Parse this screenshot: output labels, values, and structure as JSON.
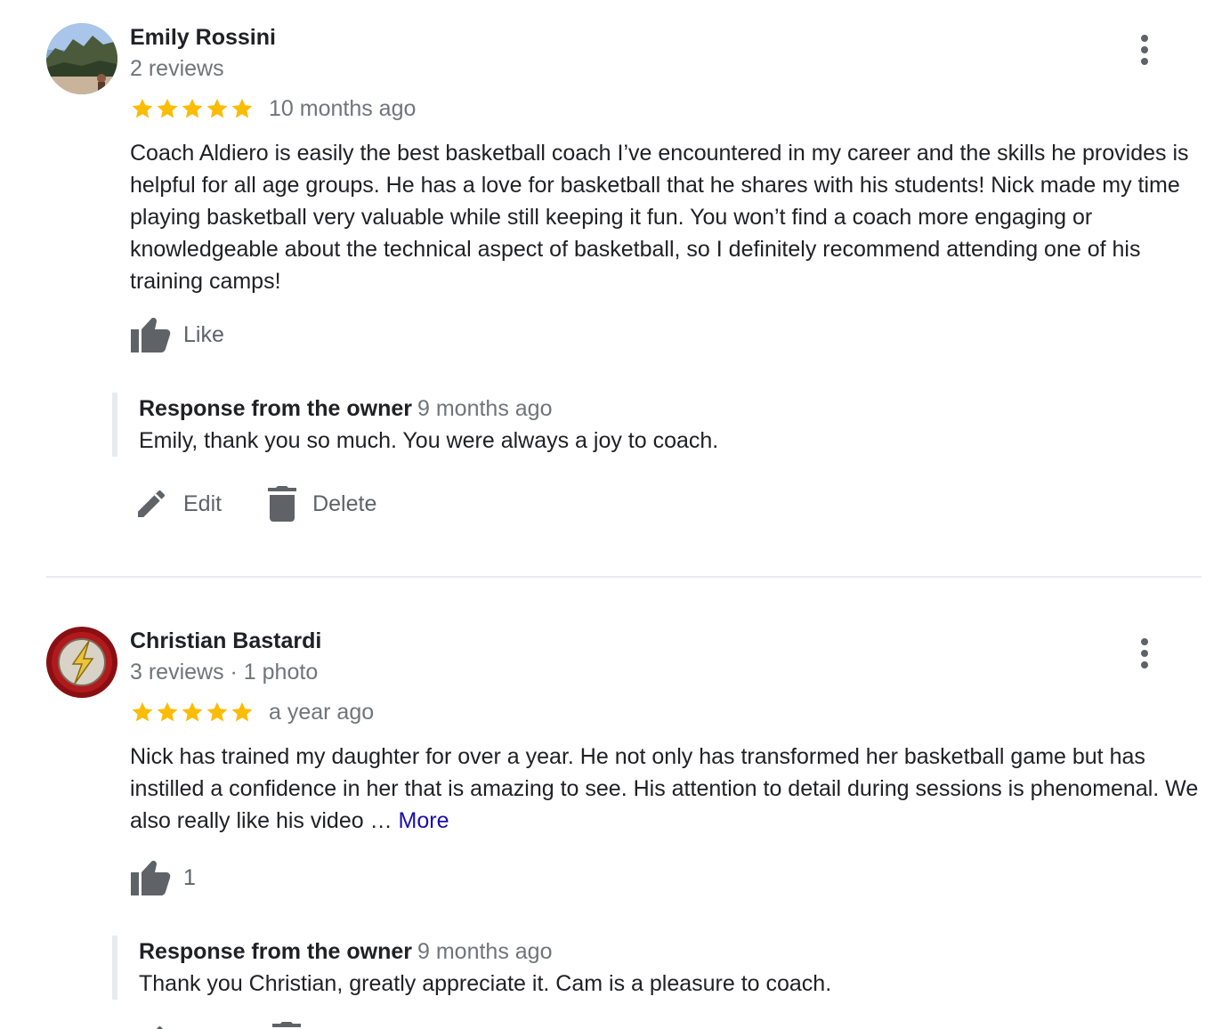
{
  "colors": {
    "star": "#fbbc04",
    "link": "#1a0dab",
    "icon": "#5f6368",
    "secondary_text": "#70757a"
  },
  "reviews": [
    {
      "author": "Emily Rossini",
      "meta": "2 reviews",
      "rating": 5,
      "date": "10 months ago",
      "text": "Coach Aldiero is easily the best basketball coach I’ve encountered in my career and the skills he provides is helpful for all age groups. He has a love for basketball that he shares with his students! Nick made my time playing basketball very valuable while still keeping it fun. You won’t find a coach more engaging or knowledgeable about the technical aspect of basketball, so I definitely recommend attending one of his training camps!",
      "more_label": "",
      "like_label": "Like",
      "response": {
        "title": "Response from the owner",
        "date": "9 months ago",
        "text": "Emily, thank you so much. You were always a joy to coach."
      },
      "actions": {
        "edit_label": "Edit",
        "delete_label": "Delete"
      }
    },
    {
      "author": "Christian Bastardi",
      "meta": "3 reviews · 1 photo",
      "rating": 5,
      "date": "a year ago",
      "text": "Nick has trained my daughter for over a year. He not only has transformed her basketball game but has instilled a confidence in her that is amazing to see. His attention to detail during sessions is phenomenal. We also really like his video … ",
      "more_label": "More",
      "like_label": "1",
      "response": {
        "title": "Response from the owner",
        "date": "9 months ago",
        "text": "Thank you Christian, greatly appreciate it. Cam is a pleasure to coach."
      }
    }
  ]
}
